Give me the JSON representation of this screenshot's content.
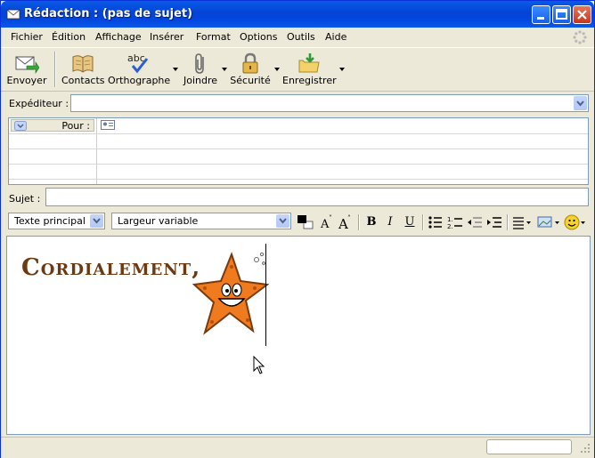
{
  "window": {
    "title": "Rédaction : (pas de sujet)"
  },
  "menu": [
    "Fichier",
    "Édition",
    "Affichage",
    "Insérer",
    "Format",
    "Options",
    "Outils",
    "Aide"
  ],
  "toolbar": {
    "send": "Envoyer",
    "contacts": "Contacts",
    "spelling": "Orthographe",
    "attach": "Joindre",
    "security": "Sécurité",
    "save": "Enregistrer"
  },
  "headers": {
    "from_label": "Expéditeur :",
    "from_value": "",
    "to_label": "Pour :",
    "subject_label": "Sujet :",
    "subject_value": ""
  },
  "format": {
    "paragraph_style": "Texte principal",
    "font": "Largeur variable",
    "bold": "B",
    "italic": "I",
    "underline": "U"
  },
  "editor": {
    "signature_text": "Cordialement,"
  },
  "colors": {
    "titlebar": "#0344d6",
    "signature": "#6b3a12",
    "starfish": "#f07a1e"
  }
}
